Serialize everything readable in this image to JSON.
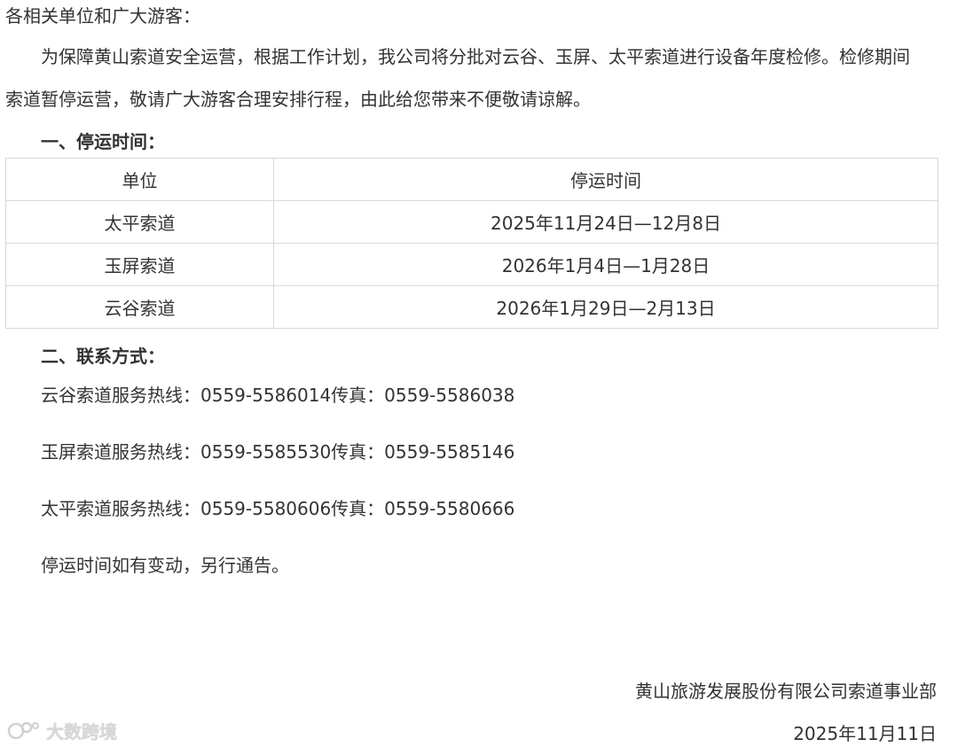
{
  "greeting": "各相关单位和广大游客：",
  "intro_line1": "为保障黄山索道安全运营，根据工作计划，我公司将分批对云谷、玉屏、太平索道进行设备年度检修。检修期间",
  "intro_line2": "索道暂停运营，敬请广大游客合理安排行程，由此给您带来不便敬请谅解。",
  "section1_title": "一、停运时间：",
  "table": {
    "headers": [
      "单位",
      "停运时间"
    ],
    "rows": [
      [
        "太平索道",
        "2025年11月24日—12月8日"
      ],
      [
        "玉屏索道",
        "2026年1月4日—1月28日"
      ],
      [
        "云谷索道",
        "2026年1月29日—2月13日"
      ]
    ]
  },
  "section2_title": "二、联系方式：",
  "contacts": [
    "云谷索道服务热线：0559-5586014传真：0559-5586038",
    "玉屏索道服务热线：0559-5585530传真：0559-5585146",
    "太平索道服务热线：0559-5580606传真：0559-5580666"
  ],
  "note": "停运时间如有变动，另行通告。",
  "signature": "黄山旅游发展股份有限公司索道事业部",
  "date": "2025年11月11日",
  "watermark": "大数跨境"
}
